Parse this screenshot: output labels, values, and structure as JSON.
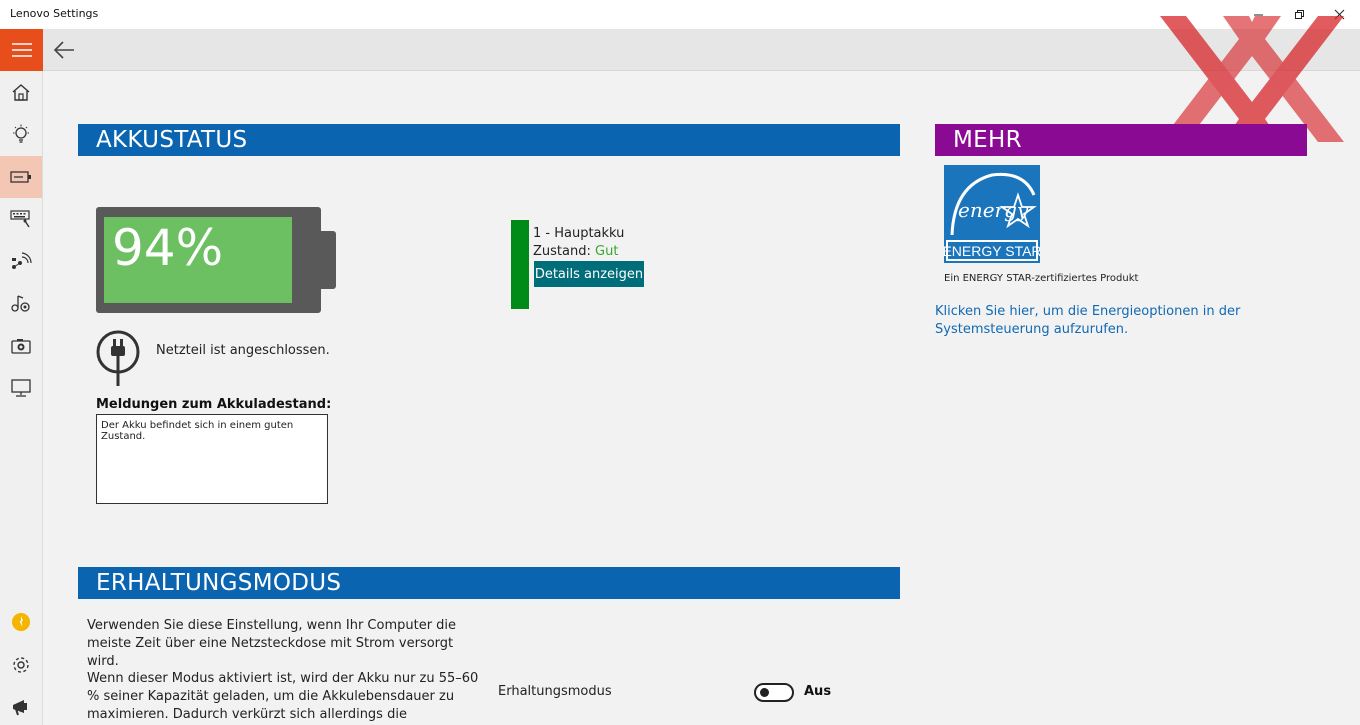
{
  "window": {
    "title": "Lenovo Settings",
    "minimize_icon": "minimize-icon",
    "maximize_icon": "restore-icon",
    "close_icon": "close-icon"
  },
  "toolbar": {
    "menu_icon": "hamburger-menu-icon",
    "back_icon": "back-arrow-icon"
  },
  "sidebar": {
    "items": [
      {
        "icon": "home-icon"
      },
      {
        "icon": "lightbulb-icon"
      },
      {
        "icon": "battery-icon",
        "active": true
      },
      {
        "icon": "keyboard-icon"
      },
      {
        "icon": "network-icon"
      },
      {
        "icon": "audio-icon"
      },
      {
        "icon": "camera-icon"
      },
      {
        "icon": "display-icon"
      }
    ],
    "bottom_items": [
      {
        "icon": "yellow-badge-icon"
      },
      {
        "icon": "gear-icon"
      },
      {
        "icon": "megaphone-icon"
      }
    ]
  },
  "akkustatus": {
    "header": "AKKUSTATUS",
    "battery_percent_label": "94%",
    "battery_level": 0.94,
    "adapter_text": "Netzteil ist angeschlossen.",
    "messages_label": "Meldungen zum Akkuladestand:",
    "messages_text": "Der Akku befindet sich in einem guten Zustand.",
    "battery_name": "1 - Hauptakku",
    "state_label": "Zustand: ",
    "state_value": "Gut",
    "details_button": "Details anzeigen",
    "colors": {
      "header": "#0a64b0",
      "fill": "#6cc062",
      "status": "#008a17"
    }
  },
  "mehr": {
    "header": "MEHR",
    "energy_star_caption": "Ein ENERGY STAR-zertifiziertes Produkt",
    "energy_star_logo_text": "ENERGY STAR",
    "energy_link": "Klicken Sie hier, um die Energieoptionen in der Systemsteuerung aufzurufen.",
    "colors": {
      "header": "#8b0a93"
    }
  },
  "erhaltungsmodus": {
    "header": "ERHALTUNGSMODUS",
    "paragraph1": "Verwenden Sie diese Einstellung, wenn Ihr Computer die meiste Zeit über eine Netzsteckdose mit Strom versorgt wird.",
    "paragraph2": "Wenn dieser Modus aktiviert ist, wird der Akku nur zu 55–60 % seiner Kapazität geladen, um die Akkulebensdauer zu maximieren. Dadurch verkürzt sich allerdings die Verwendungszeit Ihres",
    "toggle_label": "Erhaltungsmodus",
    "toggle_state": "Aus"
  }
}
